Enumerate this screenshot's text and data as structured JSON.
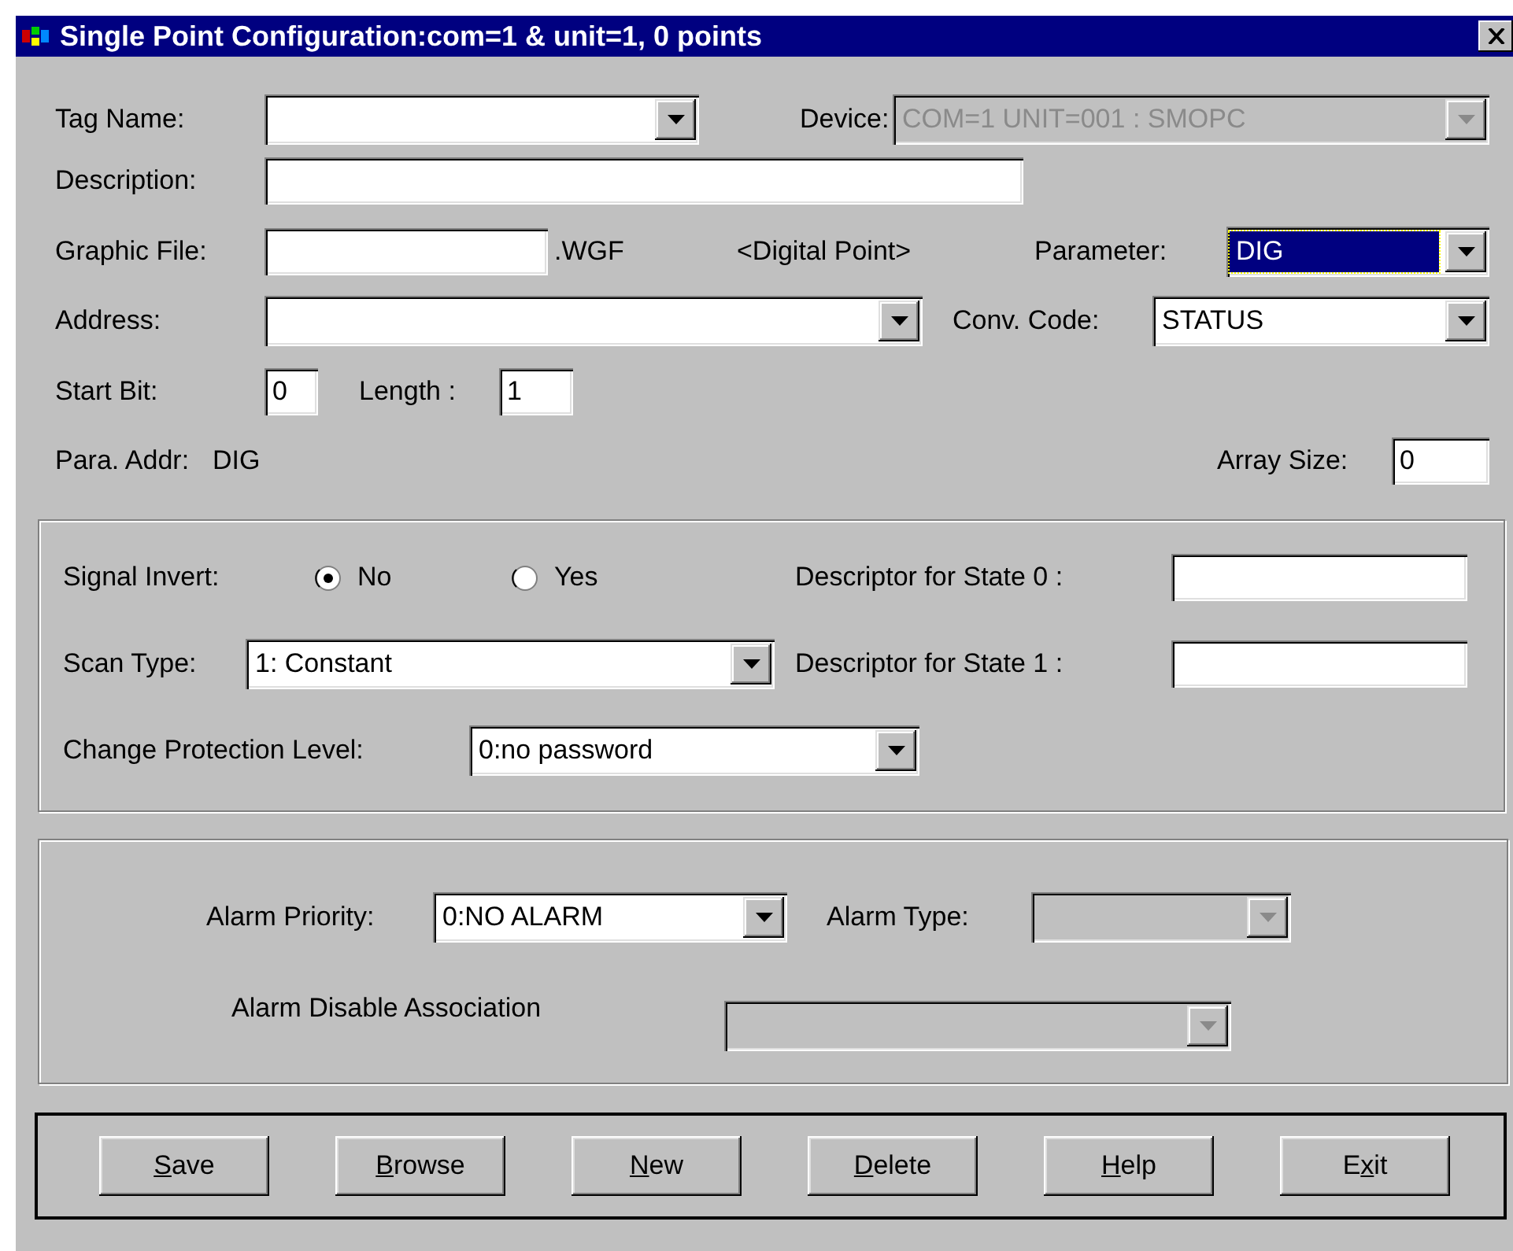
{
  "window": {
    "title": "Single Point Configuration:com=1 & unit=1, 0 points"
  },
  "tag_name": {
    "label": "Tag Name:",
    "disabled": false
  },
  "device": {
    "label": "Device:",
    "value": "COM=1 UNIT=001 : SMOPC",
    "disabled": true
  },
  "description": {
    "label": "Description:"
  },
  "graphic_file": {
    "label": "Graphic File:",
    "suffix": ".WGF"
  },
  "point_type": "<Digital Point>",
  "parameter": {
    "label": "Parameter:",
    "value": "DIG",
    "highlighted": true,
    "disabled": false
  },
  "address": {
    "label": "Address:",
    "disabled": false
  },
  "conv_code": {
    "label": "Conv. Code:",
    "value": "STATUS",
    "highlighted": false,
    "disabled": false
  },
  "start_bit": {
    "label": "Start Bit:",
    "value": "0"
  },
  "length": {
    "label": "Length :",
    "value": "1"
  },
  "para_addr": {
    "label": "Para. Addr:",
    "value": "DIG"
  },
  "array_size": {
    "label": "Array Size:",
    "value": "0"
  },
  "signal_invert": {
    "label": "Signal Invert:",
    "options": [
      {
        "label": "No",
        "selected": true
      },
      {
        "label": "Yes",
        "selected": false
      }
    ]
  },
  "descriptor_state_0": {
    "label": "Descriptor for State 0 :"
  },
  "scan_type": {
    "label": "Scan Type:",
    "value": "1: Constant",
    "disabled": false
  },
  "descriptor_state_1": {
    "label": "Descriptor for State 1 :"
  },
  "change_protection": {
    "label": "Change Protection Level:",
    "value": "0:no password",
    "disabled": false
  },
  "alarm_priority": {
    "label": "Alarm Priority:",
    "value": "0:NO ALARM",
    "disabled": false
  },
  "alarm_type": {
    "label": "Alarm Type:",
    "disabled": true
  },
  "alarm_disable_association": {
    "label": "Alarm Disable Association",
    "disabled": true
  },
  "buttons": [
    {
      "key": "S",
      "suffix": "ave"
    },
    {
      "key": "B",
      "suffix": "rowse"
    },
    {
      "key": "N",
      "suffix": "ew"
    },
    {
      "key": "D",
      "suffix": "elete"
    },
    {
      "key": "H",
      "suffix": "elp"
    },
    {
      "prefix": "E",
      "key": "x",
      "suffix": "it"
    }
  ]
}
